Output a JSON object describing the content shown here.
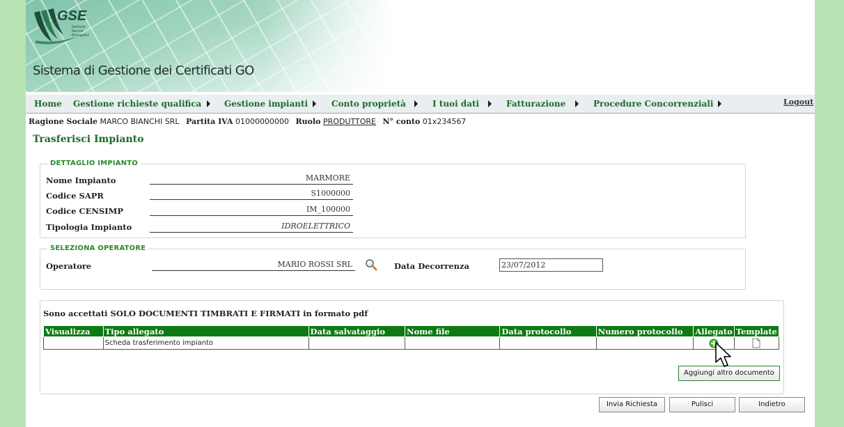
{
  "header": {
    "logo_text": "GSE",
    "logo_sub": [
      "Gestore",
      "Servizi",
      "Energetici"
    ],
    "app_title": "Sistema di Gestione dei Certificati GO"
  },
  "nav": {
    "items": [
      {
        "label": "Home"
      },
      {
        "label": "Gestione richieste qualifica"
      },
      {
        "label": "Gestione impianti"
      },
      {
        "label": "Conto proprietà"
      },
      {
        "label": "I tuoi dati"
      },
      {
        "label": "Fatturazione"
      },
      {
        "label": "Procedure Concorrenziali"
      }
    ],
    "logout": "Logout"
  },
  "info": {
    "ragione_sociale_label": "Ragione Sociale",
    "ragione_sociale": "MARCO BIANCHI SRL",
    "partita_iva_label": "Partita IVA",
    "partita_iva": "01000000000",
    "ruolo_label": "Ruolo",
    "ruolo": "PRODUTTORE",
    "conto_label": "N° conto",
    "conto": "01x234567"
  },
  "page_title": "Trasferisci Impianto",
  "dettaglio": {
    "legend": "DETTAGLIO IMPIANTO",
    "fields": [
      {
        "label": "Nome Impianto",
        "value": "MARMORE"
      },
      {
        "label": "Codice SAPR",
        "value": "S1000000"
      },
      {
        "label": "Codice CENSIMP",
        "value": "IM_100000"
      },
      {
        "label": "Tipologia Impianto",
        "value": "IDROELETTRICO"
      }
    ]
  },
  "operatore": {
    "legend": "SELEZIONA OPERATORE",
    "operatore_label": "Operatore",
    "operatore_value": "MARIO ROSSI SRL",
    "data_label": "Data Decorrenza",
    "data_value": "23/07/2012"
  },
  "documents": {
    "note": "Sono accettati SOLO DOCUMENTI TIMBRATI E FIRMATI in formato pdf",
    "columns": [
      "Visualizza",
      "Tipo allegato",
      "Data salvataggio",
      "Nome file",
      "Data protocollo",
      "Numero protocollo",
      "Allegato",
      "Template"
    ],
    "rows": [
      {
        "visualizza": "",
        "tipo": "Scheda trasferimento impianto",
        "data_salvataggio": "",
        "nome_file": "",
        "data_protocollo": "",
        "numero_protocollo": ""
      }
    ],
    "add_document": "Aggiungi altro documento"
  },
  "actions": {
    "submit": "Invia Richiesta",
    "clear": "Pulisci",
    "back": "Indietro"
  },
  "colors": {
    "brand_green": "#1e6b2a",
    "table_header": "#0d7a14",
    "side_bg": "#b9e2b5"
  },
  "icons": [
    "search-icon",
    "add-icon",
    "document-icon",
    "nav-arrow-icon",
    "cursor-icon"
  ]
}
